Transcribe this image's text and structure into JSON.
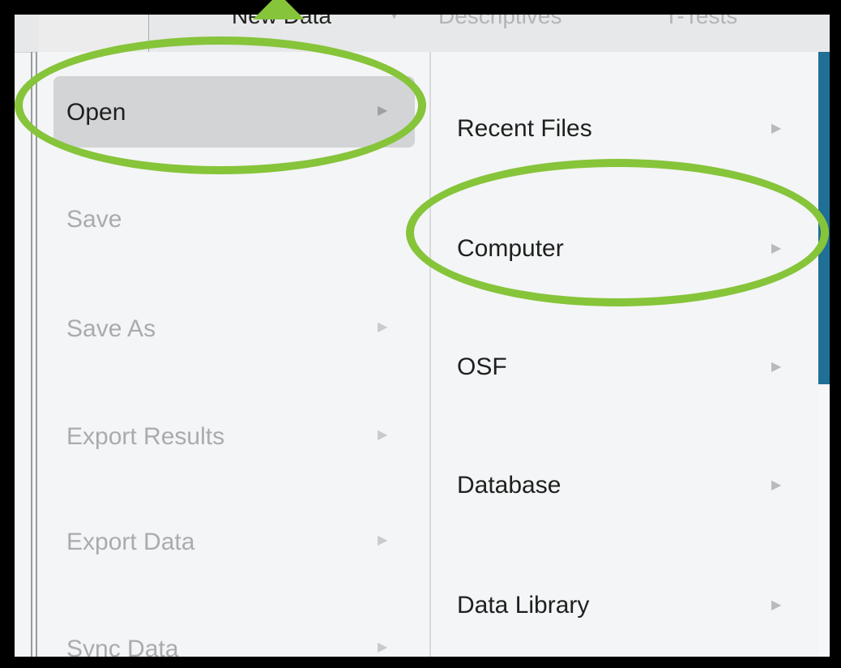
{
  "tabs": {
    "new_data": "New Data",
    "descriptives": "Descriptives",
    "ttests": "T-Tests"
  },
  "left_menu": [
    {
      "label": "Open",
      "arrow": "▶"
    },
    {
      "label": "Save",
      "arrow": ""
    },
    {
      "label": "Save As",
      "arrow": "▶"
    },
    {
      "label": "Export Results",
      "arrow": "▶"
    },
    {
      "label": "Export Data",
      "arrow": "▶"
    },
    {
      "label": "Sync Data",
      "arrow": "▶"
    }
  ],
  "right_menu": [
    {
      "label": "Recent Files",
      "arrow": "▶"
    },
    {
      "label": "Computer",
      "arrow": "▶"
    },
    {
      "label": "OSF",
      "arrow": "▶"
    },
    {
      "label": "Database",
      "arrow": "▶"
    },
    {
      "label": "Data Library",
      "arrow": "▶"
    }
  ],
  "annotation_color": "#86c43a",
  "accent_color": "#1f6f97"
}
